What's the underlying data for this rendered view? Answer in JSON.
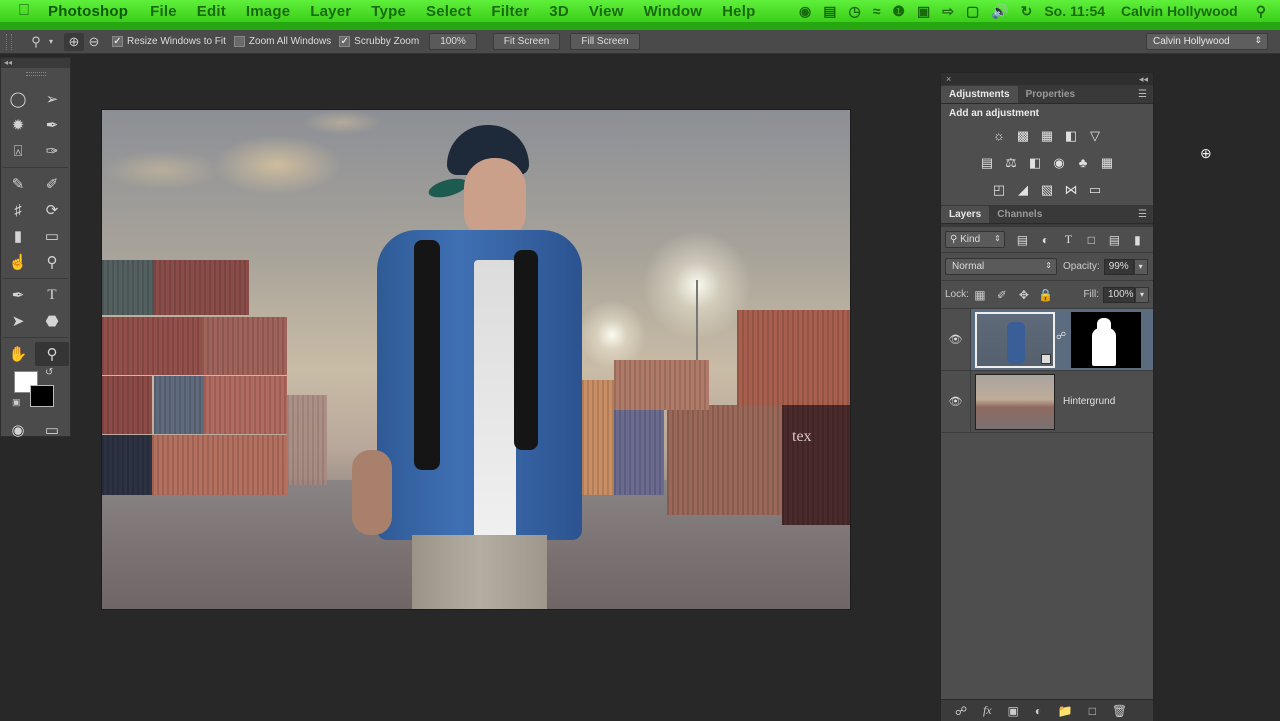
{
  "menubar": {
    "app": "Photoshop",
    "items": [
      "File",
      "Edit",
      "Image",
      "Layer",
      "Type",
      "Select",
      "Filter",
      "3D",
      "View",
      "Window",
      "Help"
    ],
    "clock": "So. 11:54",
    "user": "Calvin Hollywood",
    "status_icons": [
      "dropbox-icon",
      "messenger-icon",
      "time-machine-icon",
      "wifi-icon",
      "backup-icon",
      "display-icon",
      "arrow-icon",
      "screen-share-icon",
      "volume-icon",
      "sync-icon"
    ]
  },
  "options": {
    "resize_windows": {
      "label": "Resize Windows to Fit",
      "checked": true
    },
    "zoom_all": {
      "label": "Zoom All Windows",
      "checked": false
    },
    "scrubby": {
      "label": "Scrubby Zoom",
      "checked": true
    },
    "btn_100": "100%",
    "btn_fit": "Fit Screen",
    "btn_fill": "Fill Screen",
    "workspace": "Calvin Hollywood"
  },
  "adjustments": {
    "tabs": [
      "Adjustments",
      "Properties"
    ],
    "title": "Add an adjustment"
  },
  "layers": {
    "tabs": [
      "Layers",
      "Channels"
    ],
    "filter": "Kind",
    "blend_mode": "Normal",
    "opacity_label": "Opacity:",
    "opacity": "99%",
    "lock_label": "Lock:",
    "fill_label": "Fill:",
    "fill": "100%",
    "items": [
      {
        "name": "",
        "selected": true,
        "has_mask": true
      },
      {
        "name": "Hintergrund",
        "selected": false,
        "has_mask": false
      }
    ]
  },
  "toolbox": {
    "foreground": "#ffffff",
    "background": "#000000"
  }
}
